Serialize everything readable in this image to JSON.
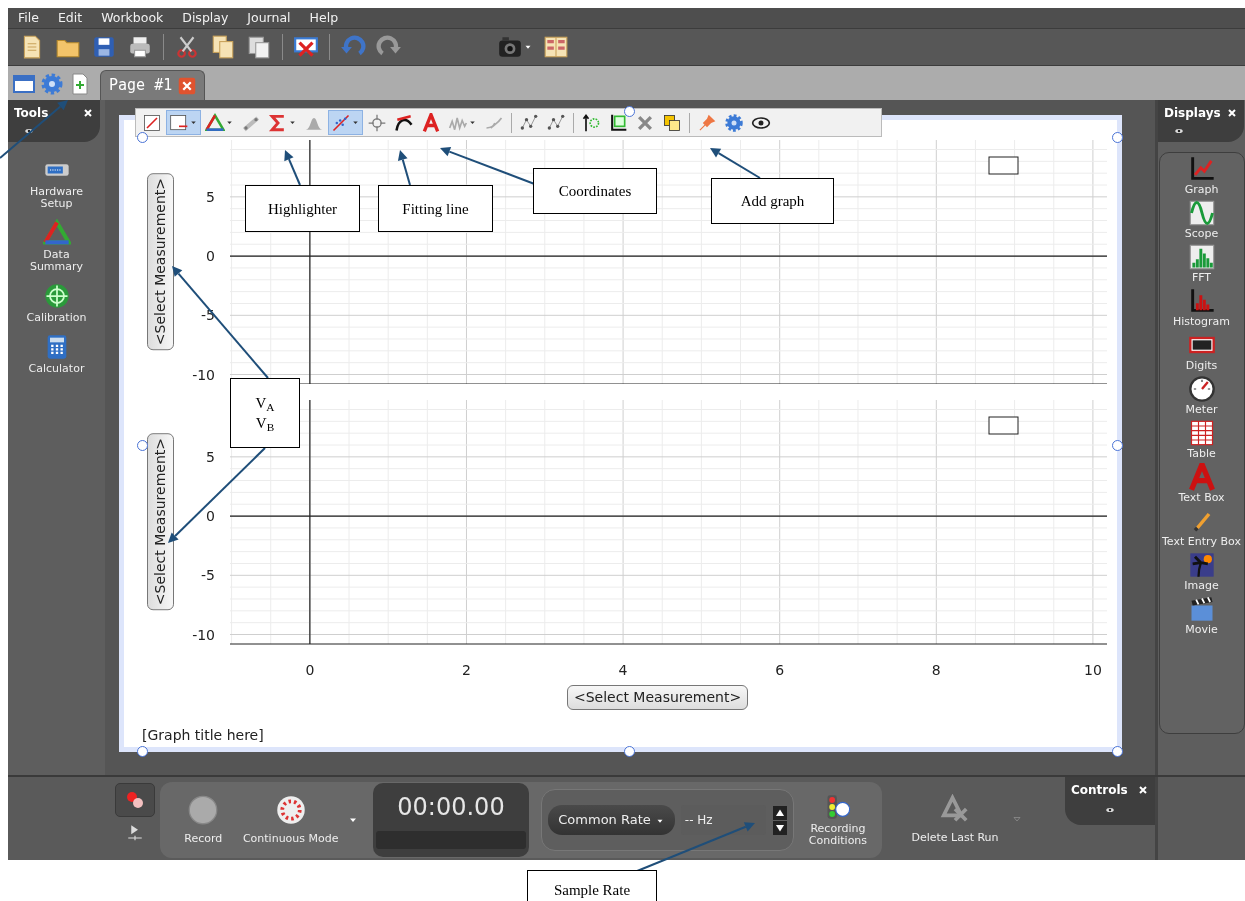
{
  "menu": [
    "File",
    "Edit",
    "Workbook",
    "Display",
    "Journal",
    "Help"
  ],
  "tabs": [
    {
      "label": "Page #1",
      "selected": true
    }
  ],
  "tools_panel": {
    "title": "Tools",
    "items": [
      {
        "kind": "hardware",
        "label": "Hardware Setup"
      },
      {
        "kind": "summary",
        "label": "Data Summary"
      },
      {
        "kind": "calibration",
        "label": "Calibration"
      },
      {
        "kind": "calculator",
        "label": "Calculator"
      }
    ]
  },
  "graph": {
    "toolbar": [
      {
        "kind": "options",
        "selected": false,
        "dropdown": false
      },
      {
        "kind": "zoom",
        "selected": true,
        "dropdown": true
      },
      {
        "kind": "triangle",
        "selected": false,
        "dropdown": true
      },
      {
        "kind": "highlighter",
        "selected": false,
        "dropdown": false
      },
      {
        "kind": "sigma",
        "selected": false,
        "dropdown": true
      },
      {
        "kind": "bell",
        "selected": false,
        "dropdown": false
      },
      {
        "kind": "fit",
        "selected": true,
        "dropdown": true
      },
      {
        "kind": "crosshair",
        "selected": false,
        "dropdown": false
      },
      {
        "kind": "tangent",
        "selected": false,
        "dropdown": false
      },
      {
        "kind": "text",
        "selected": false,
        "dropdown": false
      },
      {
        "kind": "noise",
        "selected": false,
        "dropdown": true
      },
      {
        "kind": "curve",
        "selected": false,
        "dropdown": false
      },
      {
        "kind": "points",
        "selected": false,
        "dropdown": false
      },
      {
        "kind": "points",
        "selected": false,
        "dropdown": false
      },
      {
        "kind": "addaxis",
        "selected": false,
        "dropdown": false
      },
      {
        "kind": "addgraph",
        "selected": false,
        "dropdown": false
      },
      {
        "kind": "delete",
        "selected": false,
        "dropdown": false
      },
      {
        "kind": "overlap",
        "selected": false,
        "dropdown": false
      },
      {
        "kind": "pin",
        "selected": false,
        "dropdown": false
      },
      {
        "kind": "gear",
        "selected": false,
        "dropdown": false
      },
      {
        "kind": "eye",
        "selected": false,
        "dropdown": false
      }
    ],
    "plots": [
      {
        "y_axis_label": "<Select Measurement>",
        "chart_data": {
          "type": "line",
          "xlim": [
            -1.02,
            10.18
          ],
          "ylim": [
            -10.8,
            9.8
          ],
          "yticks": [
            5,
            0,
            -5,
            -10
          ],
          "grid": true
        }
      },
      {
        "y_axis_label": "<Select Measurement>",
        "chart_data": {
          "type": "line",
          "xlim": [
            -1.02,
            10.18
          ],
          "ylim": [
            -10.8,
            9.8
          ],
          "xticks": [
            0,
            2,
            4,
            6,
            8,
            10
          ],
          "yticks": [
            5,
            0,
            -5,
            -10
          ],
          "grid": true
        }
      }
    ],
    "x_axis_label": "<Select Measurement>",
    "title": "[Graph title here]"
  },
  "displays_panel": {
    "title": "Displays",
    "items": [
      {
        "kind": "graph",
        "label": "Graph"
      },
      {
        "kind": "scope",
        "label": "Scope"
      },
      {
        "kind": "fft",
        "label": "FFT"
      },
      {
        "kind": "histogram",
        "label": "Histogram"
      },
      {
        "kind": "digits",
        "label": "Digits"
      },
      {
        "kind": "meter",
        "label": "Meter"
      },
      {
        "kind": "table",
        "label": "Table"
      },
      {
        "kind": "textbox",
        "label": "Text Box"
      },
      {
        "kind": "textentry",
        "label": "Text Entry Box"
      },
      {
        "kind": "image",
        "label": "Image"
      },
      {
        "kind": "movie",
        "label": "Movie"
      }
    ]
  },
  "controls": {
    "record": "Record",
    "mode": "Continuous Mode",
    "timer": "00:00.00",
    "rate_select": "Common Rate",
    "rate_value": "-- Hz",
    "conditions": "Recording Conditions",
    "delete_run": "Delete Last Run",
    "panel_title": "Controls"
  },
  "callouts": [
    {
      "lines": [
        "Highlighter"
      ]
    },
    {
      "lines": [
        "Fitting line"
      ]
    },
    {
      "lines": [
        "Coordinates"
      ]
    },
    {
      "lines": [
        "Add graph"
      ]
    },
    {
      "lines": [
        "V$_{A}$",
        "V$_{B}$"
      ]
    },
    {
      "lines": [
        "Sample Rate"
      ]
    }
  ]
}
